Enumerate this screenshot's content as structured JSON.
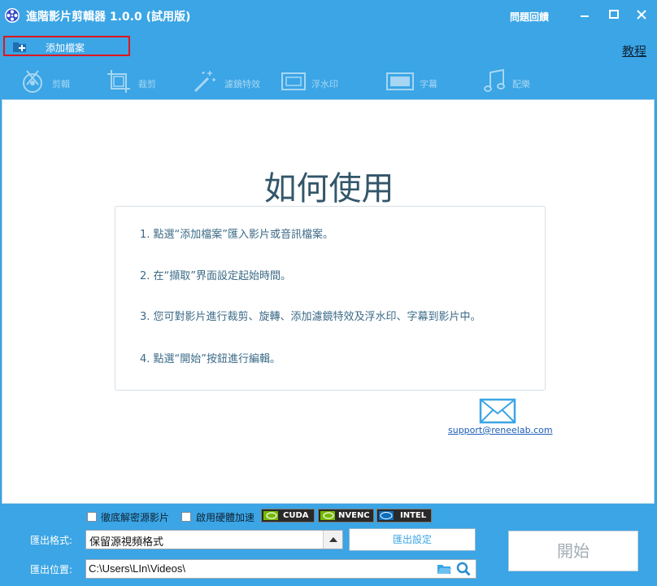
{
  "titlebar": {
    "title": "進階影片剪輯器 1.0.0 (試用版)",
    "feedback": "問題回饋",
    "minimize_icon": "minimize-icon",
    "maximize_icon": "maximize-icon",
    "close_icon": "close-icon"
  },
  "menubar": {
    "add_file_label": "添加檔案",
    "tutorial_label": "教程"
  },
  "toolbar": {
    "items": [
      {
        "label": "剪輯",
        "icon": "scissors-reel-icon"
      },
      {
        "label": "裁剪",
        "icon": "crop-icon"
      },
      {
        "label": "濾鏡特效",
        "icon": "magic-wand-icon"
      },
      {
        "label": "浮水印",
        "icon": "watermark-icon"
      },
      {
        "label": "字幕",
        "icon": "subtitle-icon"
      },
      {
        "label": "配樂",
        "icon": "music-note-icon"
      }
    ]
  },
  "howto": {
    "title": "如何使用",
    "steps": [
      "1. 點選“添加檔案”匯入影片或音訊檔案。",
      "2. 在“擷取”界面設定起始時間。",
      "3. 您可對影片進行裁剪、旋轉、添加濾鏡特效及浮水印、字幕到影片中。",
      "4. 點選“開始”按鈕進行編輯。"
    ],
    "support_email": "support@reneelab.com"
  },
  "bottom": {
    "decrypt_label": "徹底解密源影片",
    "hw_accel_label": "啟用硬體加速",
    "gpu_options": [
      "CUDA",
      "NVENC",
      "INTEL"
    ],
    "format_label": "匯出格式:",
    "format_value": "保留源視頻格式",
    "export_settings_label": "匯出設定",
    "location_label": "匯出位置:",
    "location_value": "C:\\Users\\LIn\\Videos\\",
    "start_label": "開始"
  },
  "colors": {
    "accent": "#3ba5e5",
    "highlight_border": "#e0161c",
    "heading": "#33566a",
    "step_text": "#3b6a87"
  }
}
